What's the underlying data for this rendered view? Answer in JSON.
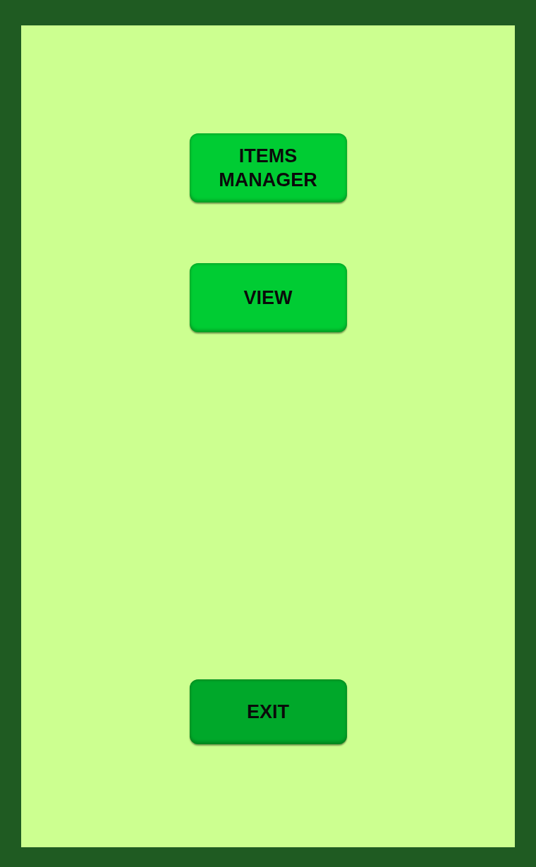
{
  "buttons": [
    {
      "label": "ITEMS\nMANAGER",
      "kind": "menu",
      "color": "#00cc33"
    },
    {
      "label": "VIEW",
      "kind": "menu",
      "color": "#00cc33"
    },
    {
      "label": "EXIT",
      "kind": "exit",
      "color": "#00a82a"
    }
  ]
}
